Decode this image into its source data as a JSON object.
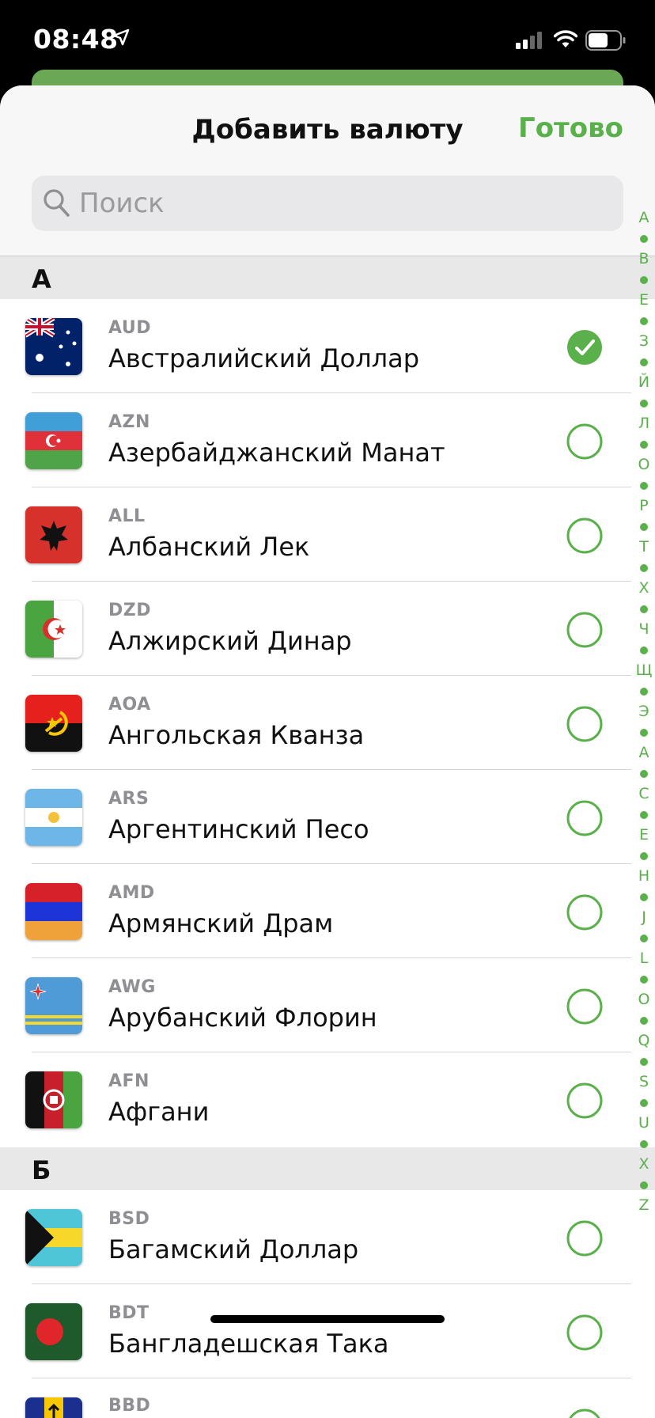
{
  "status_bar": {
    "time": "08:48"
  },
  "sheet": {
    "title": "Добавить валюту",
    "done_label": "Готово",
    "search_placeholder": "Поиск"
  },
  "colors": {
    "accent": "#5ab04a",
    "header_bg": "#f7f7f7",
    "section_bg": "#e8e8e8"
  },
  "sections": [
    {
      "letter": "А",
      "items": [
        {
          "code": "AUD",
          "name": "Австралийский Доллар",
          "selected": true,
          "flag": "australia-flag-icon"
        },
        {
          "code": "AZN",
          "name": "Азербайджанский Манат",
          "selected": false,
          "flag": "azerbaijan-flag-icon"
        },
        {
          "code": "ALL",
          "name": "Албанский Лек",
          "selected": false,
          "flag": "albania-flag-icon"
        },
        {
          "code": "DZD",
          "name": "Алжирский Динар",
          "selected": false,
          "flag": "algeria-flag-icon"
        },
        {
          "code": "AOA",
          "name": "Ангольская Кванза",
          "selected": false,
          "flag": "angola-flag-icon"
        },
        {
          "code": "ARS",
          "name": "Аргентинский Песо",
          "selected": false,
          "flag": "argentina-flag-icon"
        },
        {
          "code": "AMD",
          "name": "Армянский Драм",
          "selected": false,
          "flag": "armenia-flag-icon"
        },
        {
          "code": "AWG",
          "name": "Арубанский Флорин",
          "selected": false,
          "flag": "aruba-flag-icon"
        },
        {
          "code": "AFN",
          "name": "Афгани",
          "selected": false,
          "flag": "afghanistan-flag-icon"
        }
      ]
    },
    {
      "letter": "Б",
      "items": [
        {
          "code": "BSD",
          "name": "Багамский Доллар",
          "selected": false,
          "flag": "bahamas-flag-icon"
        },
        {
          "code": "BDT",
          "name": "Бангладешская Така",
          "selected": false,
          "flag": "bangladesh-flag-icon"
        },
        {
          "code": "BBD",
          "name": "",
          "selected": false,
          "flag": "barbados-flag-icon"
        }
      ]
    }
  ],
  "index_letters": [
    "А",
    "В",
    "Е",
    "З",
    "Й",
    "Л",
    "О",
    "Р",
    "Т",
    "Х",
    "Ч",
    "Щ",
    "Э",
    "A",
    "C",
    "E",
    "H",
    "J",
    "L",
    "O",
    "Q",
    "S",
    "U",
    "X",
    "Z"
  ]
}
